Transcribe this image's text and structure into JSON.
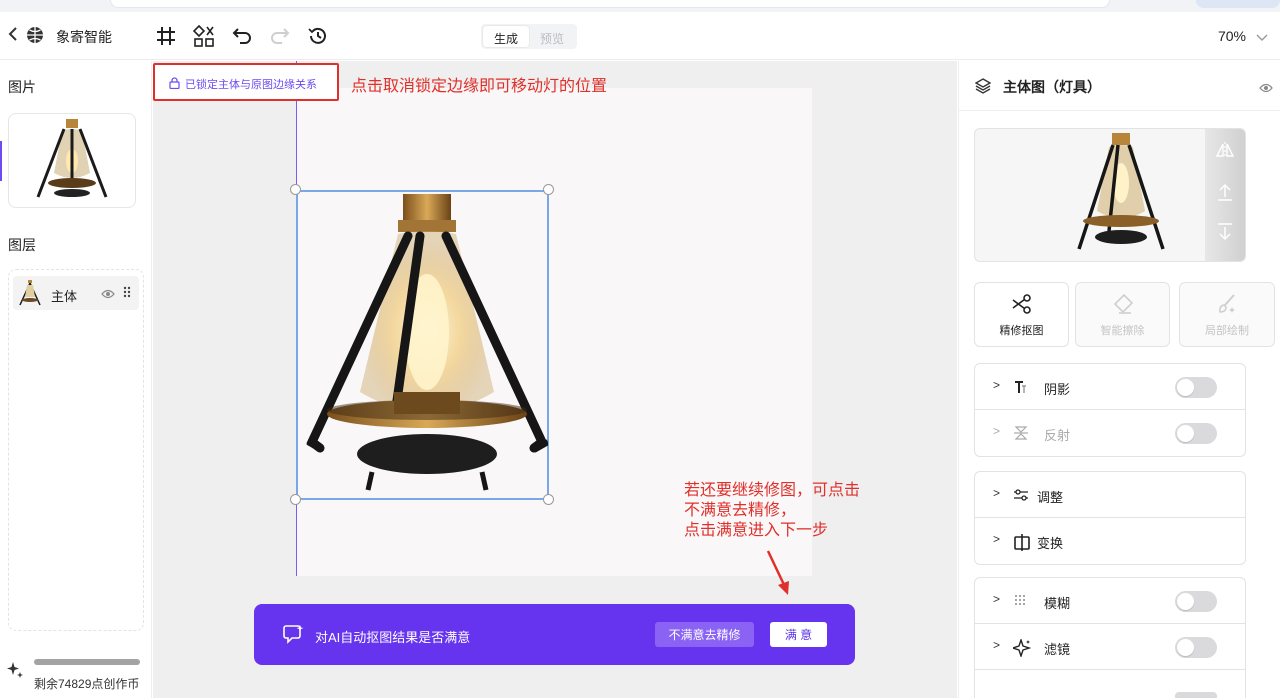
{
  "app": {
    "name": "象寄智能"
  },
  "toolbar": {
    "generate_tab": "生成",
    "preview_tab": "预览",
    "zoom": "70%"
  },
  "left": {
    "images_title": "图片",
    "layers_title": "图层",
    "layer_name": "主体",
    "credits": "剩余74829点创作币"
  },
  "canvas": {
    "lock_label": "已锁定主体与原图边缘关系",
    "annotation_top": "点击取消锁定边缘即可移动灯的位置",
    "annotation_bottom": [
      "若还要继续修图，可点击",
      "不满意去精修，",
      "点击满意进入下一步"
    ],
    "feedback_question": "对AI自动抠图结果是否满意",
    "btn_unsatisfied": "不满意去精修",
    "btn_satisfied": "满 意"
  },
  "right": {
    "title": "主体图（灯具）",
    "tools": [
      {
        "label": "精修抠图",
        "enabled": true
      },
      {
        "label": "智能擦除",
        "enabled": false
      },
      {
        "label": "局部绘制",
        "enabled": false
      }
    ],
    "group1": [
      {
        "label": "阴影",
        "enabled": true,
        "toggle": false
      },
      {
        "label": "反射",
        "enabled": false,
        "toggle": false
      }
    ],
    "group2": [
      {
        "label": "调整"
      },
      {
        "label": "变换"
      }
    ],
    "group3": [
      {
        "label": "模糊",
        "toggle": false
      },
      {
        "label": "滤镜",
        "toggle": false
      }
    ]
  },
  "colors": {
    "accent": "#6633ee",
    "annotation": "#e0302b",
    "selection": "#7aa7e8"
  },
  "icons": [
    "back-icon",
    "logo-icon",
    "crop-icon",
    "transform-icon",
    "undo-icon",
    "redo-icon",
    "history-icon",
    "chevron-down-icon",
    "lock-icon",
    "eye-icon",
    "drag-handle-icon",
    "sparkle-icon",
    "layers-icon",
    "flip-icon",
    "move-up-icon",
    "move-down-icon",
    "scissors-icon",
    "eraser-icon",
    "brush-icon",
    "shadow-icon",
    "reflect-icon",
    "adjust-icon",
    "transform-icon",
    "blur-icon",
    "filter-icon",
    "feedback-icon"
  ]
}
